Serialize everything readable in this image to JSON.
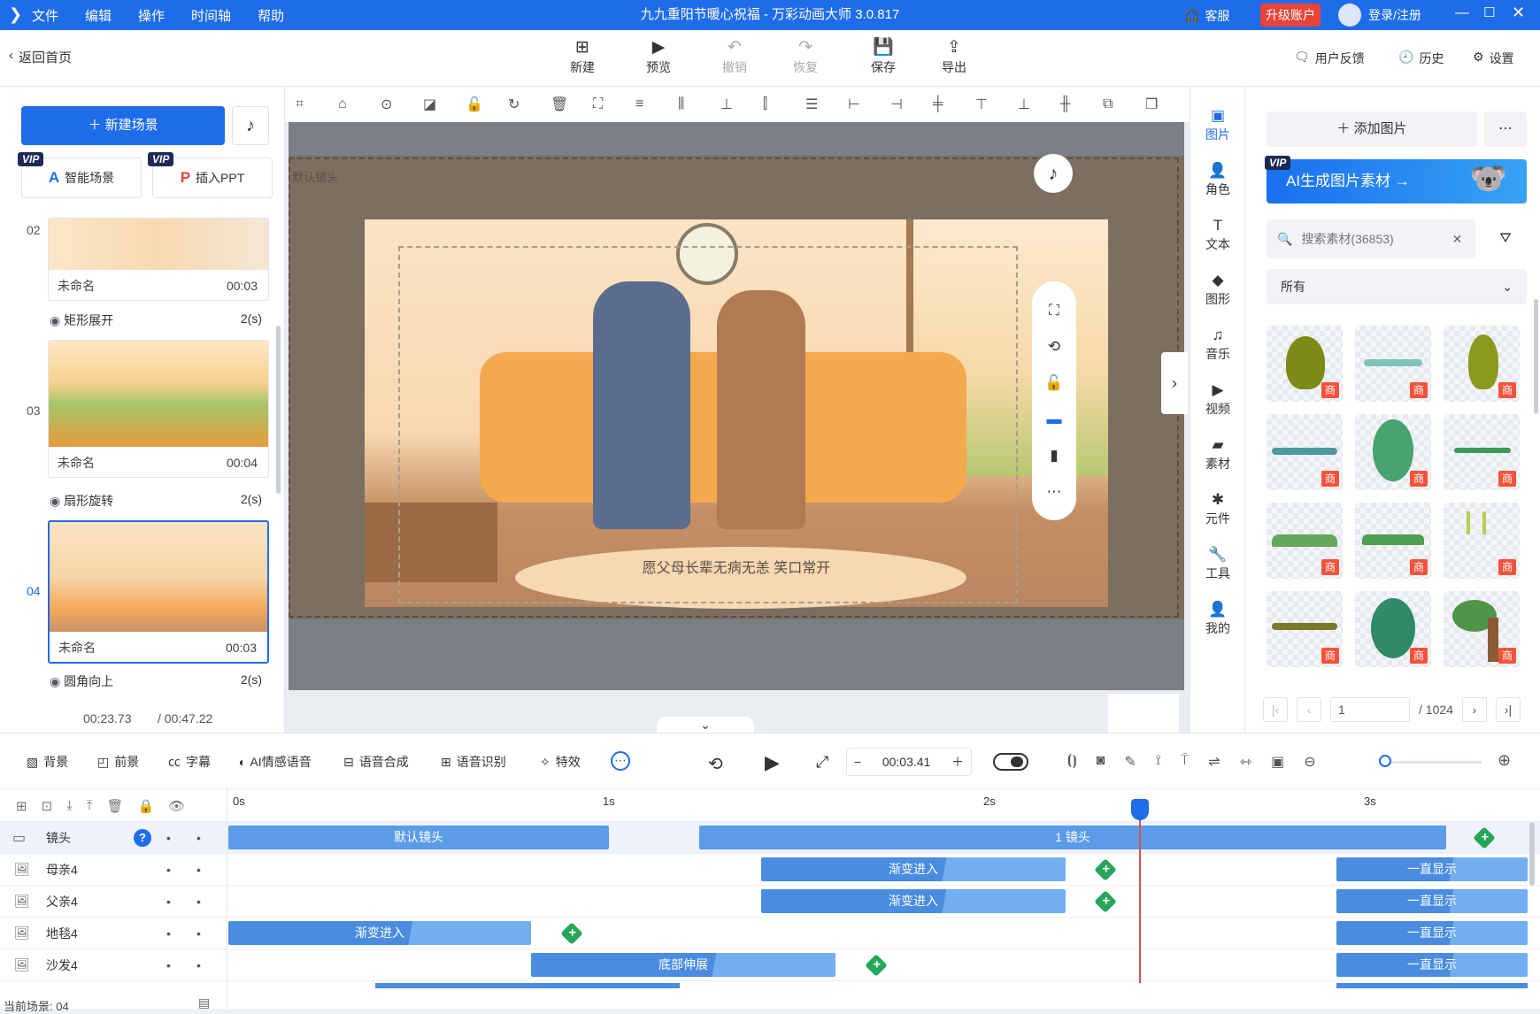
{
  "titlebar": {
    "menu": [
      "文件",
      "编辑",
      "操作",
      "时间轴",
      "帮助"
    ],
    "title": "九九重阳节暖心祝福 - 万彩动画大师 3.0.817",
    "support": "客服",
    "upgrade": "升级账户",
    "login": "登录/注册"
  },
  "toolbar": {
    "back": "返回首页",
    "new": "新建",
    "preview": "预览",
    "undo": "撤销",
    "redo": "恢复",
    "save": "保存",
    "export": "导出",
    "feedback": "用户反馈",
    "history": "历史",
    "settings": "设置"
  },
  "left": {
    "new_scene": "新建场景",
    "smart_scene": "智能场景",
    "insert_ppt": "插入PPT",
    "vip": "VIP",
    "scenes": [
      {
        "num": "02",
        "name": "未命名",
        "time": "00:03",
        "transition": "矩形展开",
        "dur": "2(s)"
      },
      {
        "num": "03",
        "name": "未命名",
        "time": "00:04",
        "transition": "扇形旋转",
        "dur": "2(s)"
      },
      {
        "num": "04",
        "name": "未命名",
        "time": "00:03",
        "transition": "圆角向上",
        "dur": "2(s)"
      }
    ],
    "current_time": "00:23.73",
    "total_time": "/ 00:47.22"
  },
  "canvas": {
    "camera_label": "默认镜头",
    "caption": "愿父母长辈无病无恙 笑口常开"
  },
  "rtabs": [
    "图片",
    "角色",
    "文本",
    "图形",
    "音乐",
    "视频",
    "素材",
    "元件",
    "工具",
    "我的"
  ],
  "rpanel": {
    "add_image": "添加图片",
    "ai_banner": "AI生成图片素材 →",
    "search_placeholder": "搜索素材(36853)",
    "filter": "所有",
    "asset_tag": "商",
    "page": "1",
    "total_pages": "/ 1024"
  },
  "timeline": {
    "tools": [
      "背景",
      "前景",
      "字幕",
      "AI情感语音",
      "语音合成",
      "语音识别",
      "特效"
    ],
    "time_value": "00:03.41",
    "ruler": [
      "0s",
      "1s",
      "2s",
      "3s"
    ],
    "rows": [
      {
        "name": "镜头",
        "bars": [
          {
            "label": "默认镜头"
          },
          {
            "label": "1 镜头"
          }
        ]
      },
      {
        "name": "母亲4",
        "bars": [
          {
            "label": "渐变进入"
          },
          {
            "label": "一直显示"
          }
        ]
      },
      {
        "name": "父亲4",
        "bars": [
          {
            "label": "渐变进入"
          },
          {
            "label": "一直显示"
          }
        ]
      },
      {
        "name": "地毯4",
        "bars": [
          {
            "label": "渐变进入"
          },
          {
            "label": "一直显示"
          }
        ]
      },
      {
        "name": "沙发4",
        "bars": [
          {
            "label": "底部伸展"
          },
          {
            "label": "一直显示"
          }
        ]
      }
    ],
    "current_scene": "当前场景: 04"
  }
}
